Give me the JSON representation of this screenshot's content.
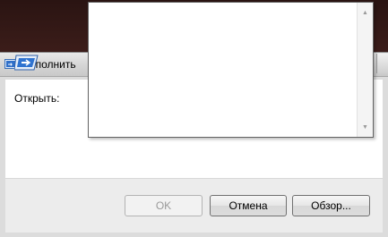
{
  "window": {
    "title": "Выполнить",
    "icon": "run-icon"
  },
  "form": {
    "open_label": "Открыть:",
    "open_value": ""
  },
  "buttons": {
    "ok": "OK",
    "cancel": "Отмена",
    "browse": "Обзор..."
  },
  "dropdown": {
    "items": [],
    "scroll_up": "▲",
    "scroll_down": "▼"
  },
  "colors": {
    "accent": "#1f5fb4",
    "input_border": "#7f9db9"
  }
}
